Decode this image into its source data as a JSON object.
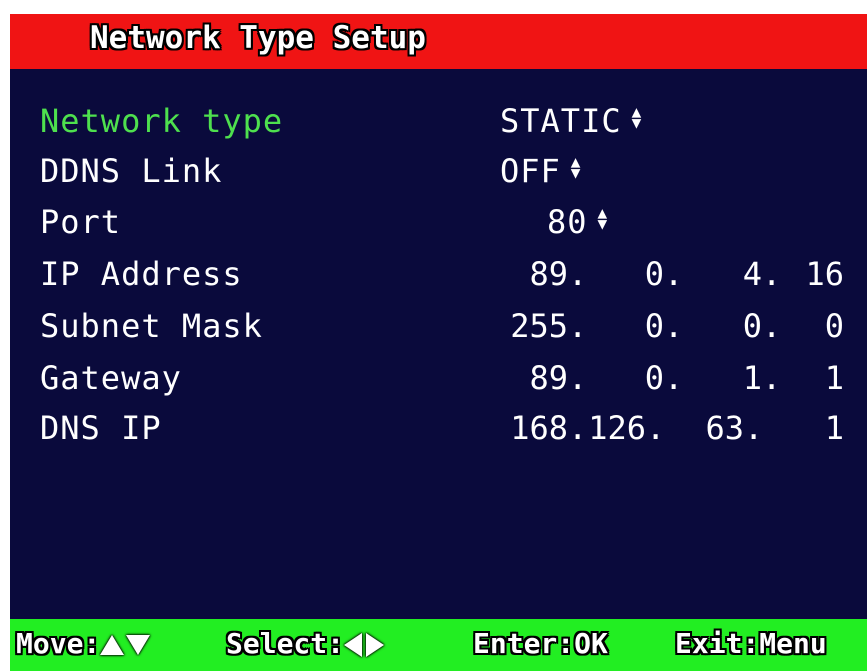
{
  "title": "Network Type Setup",
  "colors": {
    "title_bar": "#f01414",
    "background": "#0a0a3c",
    "footer_bar": "#22ee22",
    "active_label": "#4ee04e",
    "text": "#ffffff"
  },
  "settings": {
    "network_type": {
      "label": "Network type",
      "value": "STATIC"
    },
    "ddns_link": {
      "label": "DDNS Link",
      "value": "OFF"
    },
    "port": {
      "label": "Port",
      "value": "80"
    },
    "ip_address": {
      "label": "IP Address",
      "octets": [
        "89",
        "0",
        "4",
        "16"
      ]
    },
    "subnet_mask": {
      "label": "Subnet Mask",
      "octets": [
        "255",
        "0",
        "0",
        "0"
      ]
    },
    "gateway": {
      "label": "Gateway",
      "octets": [
        "89",
        "0",
        "1",
        "1"
      ]
    },
    "dns_ip": {
      "label": "DNS IP",
      "octets": [
        "168",
        "126",
        "63",
        "1"
      ]
    }
  },
  "footer": {
    "move_label": "Move:",
    "select_label": "Select:",
    "enter_label": "Enter:OK",
    "exit_label": "Exit:Menu"
  },
  "icons": {
    "up_down_arrow": "up-down-arrow-icon",
    "move_up": "triangle-up-icon",
    "move_down": "triangle-down-icon",
    "select_left": "triangle-left-icon",
    "select_right": "triangle-right-icon"
  }
}
